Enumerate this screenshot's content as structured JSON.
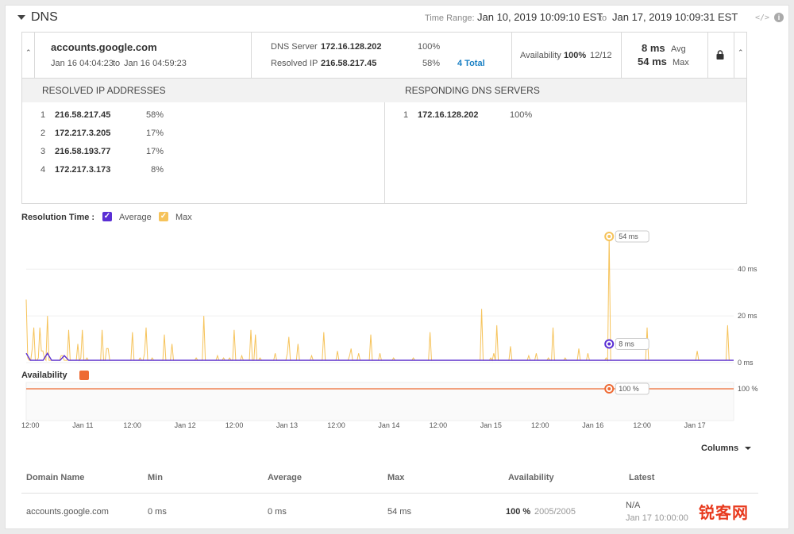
{
  "header": {
    "title": "DNS",
    "time_range_label": "Time Range:",
    "time_range_from": "Jan 10, 2019 10:09:10 EST",
    "time_range_to_label": "to",
    "time_range_to": "Jan 17, 2019 10:09:31 EST",
    "code_glyph": "</>",
    "info_glyph": "i"
  },
  "summary": {
    "domain": "accounts.google.com",
    "period_from": "Jan 16 04:04:23",
    "period_to_label": "to",
    "period_to": "Jan 16 04:59:23",
    "dns_server_label": "DNS Server",
    "dns_server_value": "172.16.128.202",
    "dns_server_pct": "100%",
    "resolved_ip_label": "Resolved IP",
    "resolved_ip_value": "216.58.217.45",
    "resolved_ip_pct": "58%",
    "total_link": "4 Total",
    "availability_label": "Availability",
    "availability_pct": "100%",
    "availability_count": "12/12",
    "avg_value": "8 ms",
    "avg_label": "Avg",
    "max_value": "54 ms",
    "max_label": "Max",
    "chevron_glyph": "⌃"
  },
  "details": {
    "resolved_header": "RESOLVED IP ADDRESSES",
    "responding_header": "RESPONDING DNS SERVERS",
    "resolved": [
      {
        "idx": "1",
        "ip": "216.58.217.45",
        "pct": "58%"
      },
      {
        "idx": "2",
        "ip": "172.217.3.205",
        "pct": "17%"
      },
      {
        "idx": "3",
        "ip": "216.58.193.77",
        "pct": "17%"
      },
      {
        "idx": "4",
        "ip": "172.217.3.173",
        "pct": "8%"
      }
    ],
    "responding": [
      {
        "idx": "1",
        "ip": "172.16.128.202",
        "pct": "100%"
      }
    ]
  },
  "legend": {
    "title": "Resolution Time :",
    "average_label": "Average",
    "max_label": "Max",
    "availability_title": "Availability",
    "average_color": "#5a2fd4",
    "max_color": "#f6c35a",
    "availability_color": "#ee6a33",
    "check_glyph": "✓"
  },
  "chart_data": {
    "type": "line",
    "ylabel": "",
    "ylim": [
      0,
      54
    ],
    "y_ticks": [
      "40 ms",
      "20 ms",
      "0 ms"
    ],
    "y_tick_values": [
      40,
      20,
      0
    ],
    "availability_tick": "100 %",
    "x_ticks": [
      "12:00",
      "Jan 11",
      "12:00",
      "Jan 12",
      "12:00",
      "Jan 13",
      "12:00",
      "Jan 14",
      "12:00",
      "Jan 15",
      "12:00",
      "Jan 16",
      "12:00",
      "Jan 17"
    ],
    "n_points": 168,
    "series": [
      {
        "name": "Max",
        "values": [
          27,
          2,
          1,
          1,
          6,
          15,
          1,
          1,
          2,
          15,
          5,
          5,
          2,
          1,
          20,
          1,
          1,
          1,
          1,
          1,
          1,
          1,
          1,
          3,
          3,
          1,
          1,
          1,
          14,
          1,
          1,
          1,
          1,
          1,
          8,
          1,
          2,
          14,
          1,
          1,
          2,
          1,
          1,
          1,
          1,
          1,
          1,
          1,
          1,
          1,
          14,
          1,
          1,
          6,
          6,
          1,
          1,
          1,
          1,
          1,
          1,
          1,
          1,
          1,
          1,
          1,
          1,
          1,
          1,
          1,
          13,
          1,
          1,
          1,
          1,
          2,
          1,
          1,
          4,
          15,
          1,
          1,
          1,
          2,
          1,
          1,
          1,
          1,
          1,
          1,
          1,
          12,
          1,
          1,
          1,
          1,
          8,
          1,
          1,
          1,
          1,
          1,
          1,
          1,
          1,
          1,
          1,
          1,
          1,
          1,
          1,
          1,
          2,
          1,
          1,
          1,
          1,
          20,
          1,
          1,
          1,
          1,
          1,
          1,
          1,
          1,
          3,
          1,
          1,
          1,
          2,
          1,
          1,
          1,
          2,
          1,
          1,
          14,
          1,
          1,
          1,
          1,
          3,
          1,
          1,
          1,
          1,
          1,
          14,
          1,
          1,
          12,
          1,
          1,
          2,
          1,
          1,
          1,
          1,
          1,
          1,
          1,
          1,
          1,
          4,
          1,
          1,
          1,
          1,
          1,
          1,
          1,
          4,
          11,
          1,
          1,
          1,
          1,
          1,
          8,
          1,
          1,
          1,
          1,
          1,
          1,
          1,
          1,
          3,
          1,
          1,
          1,
          1,
          1,
          1,
          1,
          13,
          1,
          1,
          1,
          1,
          1,
          1,
          1,
          1,
          5,
          1,
          1,
          1,
          1,
          1,
          1,
          1,
          3,
          6,
          1,
          1,
          1,
          1,
          4,
          1,
          1,
          1,
          1,
          1,
          1,
          1,
          12,
          1,
          1,
          1,
          1,
          1,
          4,
          1,
          1,
          1,
          1,
          1,
          1,
          1,
          1,
          2,
          1,
          1,
          1,
          1,
          1,
          1,
          1,
          1,
          1,
          1,
          1,
          1,
          2,
          1,
          1,
          1,
          1,
          1,
          1,
          1,
          1,
          1,
          1,
          13,
          1,
          1,
          1,
          1,
          1,
          1,
          1,
          1,
          1,
          1,
          1,
          1,
          1,
          1,
          1,
          1,
          1,
          1,
          1,
          1,
          1,
          1,
          1,
          1,
          1,
          1,
          1,
          1,
          1,
          1,
          1,
          1,
          1,
          23,
          1,
          1,
          1,
          1,
          1,
          2,
          1,
          4,
          1,
          16,
          1,
          1,
          1,
          1,
          1,
          1,
          1,
          1,
          7,
          1,
          1,
          1,
          1,
          1,
          1,
          1,
          1,
          1,
          1,
          1,
          3,
          1,
          1,
          1,
          1,
          4,
          1,
          1,
          1,
          1,
          1,
          1,
          1,
          2,
          1,
          1,
          15,
          1,
          1,
          1,
          1,
          1,
          1,
          1,
          2,
          1,
          1,
          1,
          1,
          1,
          1,
          1,
          1,
          6,
          1,
          1,
          1,
          1,
          1,
          4,
          1,
          1,
          1,
          1,
          1,
          1,
          1,
          1,
          1,
          1,
          1,
          2,
          1,
          54,
          1,
          1,
          1,
          1,
          1,
          1,
          1,
          1,
          1,
          1,
          1,
          1,
          1,
          1,
          1,
          1,
          1,
          1,
          1,
          1,
          1,
          1,
          1,
          1,
          15,
          1,
          1,
          1,
          1,
          1,
          1,
          1,
          1,
          1,
          1,
          1,
          1,
          1,
          1,
          1,
          1,
          1,
          1,
          1,
          1,
          1,
          1,
          1,
          1,
          1,
          1,
          1,
          1,
          1,
          1,
          1,
          1,
          5,
          1,
          1,
          1,
          1,
          1,
          1,
          1,
          1,
          1,
          1,
          1,
          1,
          1,
          1,
          1,
          1,
          1,
          1,
          1,
          16,
          1,
          1,
          1,
          1
        ]
      },
      {
        "name": "Average",
        "values": [
          4,
          1,
          1,
          1,
          1,
          4,
          1,
          1,
          1,
          3,
          1,
          1,
          1,
          1,
          1,
          1,
          1,
          1,
          1,
          1,
          1,
          1,
          1,
          1,
          1,
          1,
          1,
          1,
          1,
          1,
          1,
          1,
          1,
          1,
          1,
          1,
          1,
          1,
          1,
          1,
          1,
          1,
          1,
          1,
          1,
          1,
          1,
          1,
          1,
          1,
          1,
          1,
          1,
          1,
          1,
          1,
          1,
          1,
          1,
          1,
          1,
          1,
          1,
          1,
          1,
          1,
          1,
          1,
          1,
          1,
          1,
          1,
          1,
          1,
          1,
          1,
          1,
          1,
          1,
          1,
          1,
          1,
          1,
          1,
          1,
          1,
          1,
          1,
          1,
          1,
          1,
          1,
          1,
          1,
          1,
          1,
          1,
          1,
          1,
          1,
          1,
          1,
          1,
          1,
          1,
          1,
          1,
          1,
          1,
          1,
          1,
          1,
          1,
          1,
          1,
          1,
          1,
          1,
          1,
          1,
          1,
          1,
          1,
          1,
          1,
          1,
          1,
          1,
          1,
          1,
          1,
          1,
          1,
          1,
          1,
          1,
          1,
          1,
          1,
          1,
          1,
          1,
          1,
          1,
          1,
          1,
          1,
          1,
          1,
          1,
          1,
          1,
          1,
          1,
          1,
          1,
          1,
          1,
          1,
          1,
          1,
          1,
          1,
          1,
          1,
          1,
          1,
          1
        ]
      }
    ],
    "tooltip_max": "54 ms",
    "tooltip_avg": "8 ms",
    "tooltip_availability": "100 %",
    "tooltip_index": 128,
    "highlight_avg_value": 8
  },
  "table": {
    "columns_button": "Columns",
    "headers": [
      "Domain Name",
      "Min",
      "Average",
      "Max",
      "Availability",
      "Latest"
    ],
    "row": {
      "domain": "accounts.google.com",
      "min": "0 ms",
      "average": "0 ms",
      "max": "54 ms",
      "availability_pct": "100 %",
      "availability_count": "2005/2005",
      "latest_value": "N/A",
      "latest_time": "Jan 17 10:00:00"
    }
  },
  "watermark": "锐客网"
}
